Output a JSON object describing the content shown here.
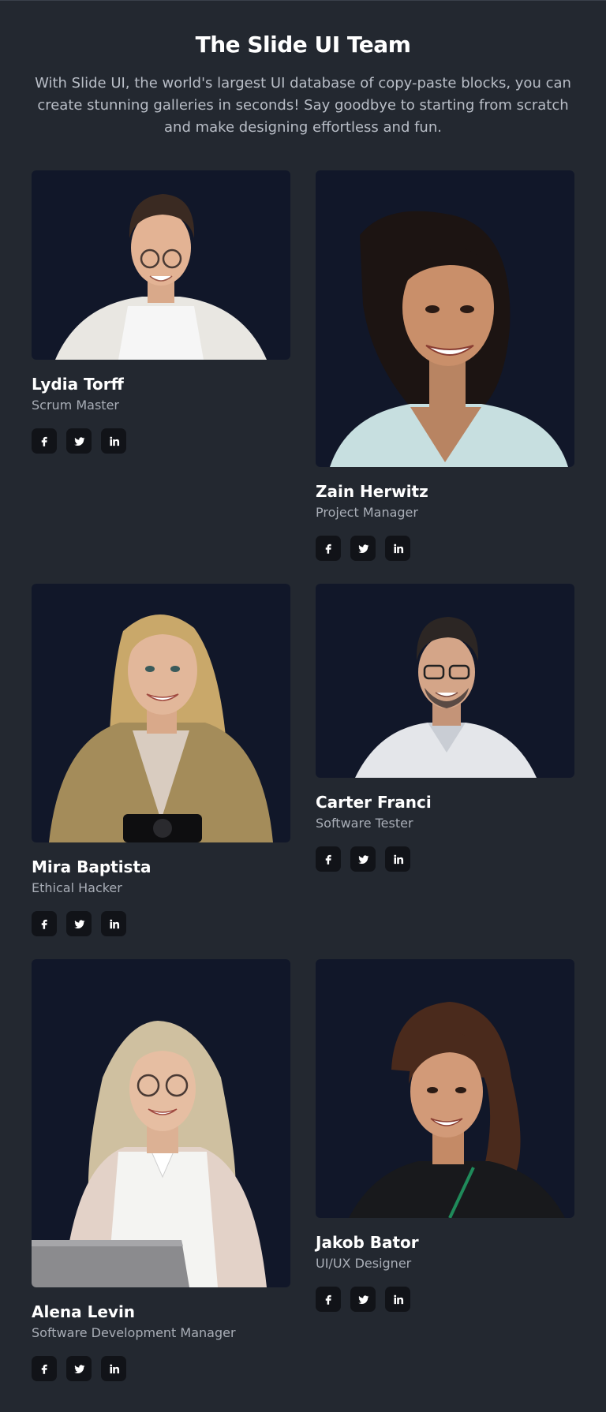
{
  "header": {
    "title": "The Slide UI Team",
    "subtitle": "With Slide UI, the world's largest UI database of copy-paste blocks, you can create stunning galleries in seconds! Say goodbye to starting from scratch and make designing effortless and fun."
  },
  "colors": {
    "page_bg": "#232830",
    "photo_bg": "#111729",
    "social_bg": "#111318"
  },
  "team": [
    {
      "name": "Lydia Torff",
      "role": "Scrum Master"
    },
    {
      "name": "Zain Herwitz",
      "role": "Project Manager"
    },
    {
      "name": "Mira Baptista",
      "role": "Ethical Hacker"
    },
    {
      "name": "Carter Franci",
      "role": "Software Tester"
    },
    {
      "name": "Alena Levin",
      "role": "Software Development Manager"
    },
    {
      "name": "Jakob Bator",
      "role": "UI/UX Designer"
    }
  ],
  "social_icons": [
    "facebook-icon",
    "twitter-icon",
    "linkedin-icon"
  ]
}
